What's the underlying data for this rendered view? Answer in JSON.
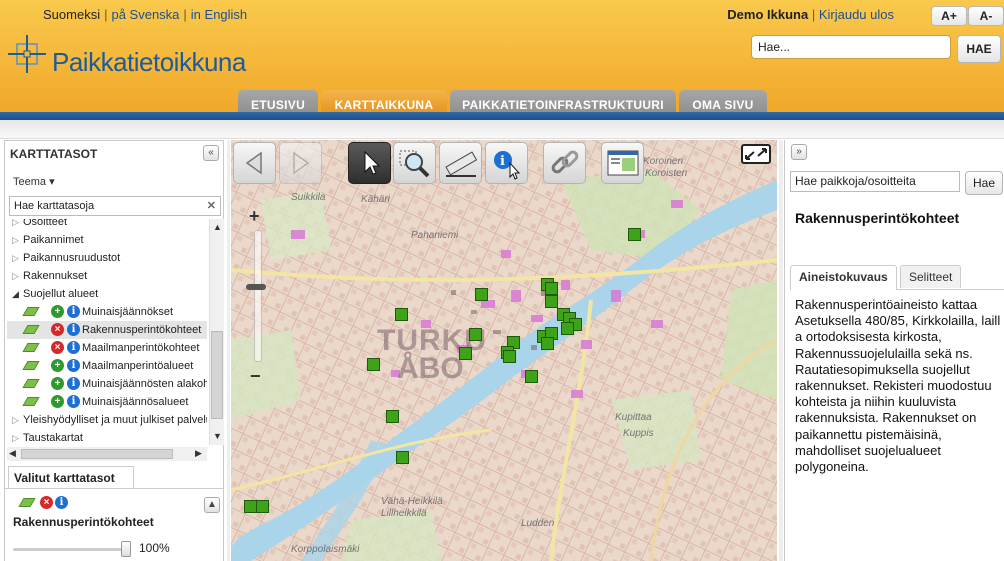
{
  "header": {
    "languages": [
      "Suomeksi",
      "på Svenska",
      "in English"
    ],
    "user_name": "Demo Ikkuna",
    "logout": "Kirjaudu ulos",
    "font_bigger": "A+",
    "font_smaller": "A-",
    "logo_text": "Paikkatietoikkuna",
    "search_placeholder": "Hae...",
    "search_button": "HAE"
  },
  "nav": {
    "tabs": [
      {
        "label": "ETUSIVU",
        "active": false
      },
      {
        "label": "KARTTAIKKUNA",
        "active": true
      },
      {
        "label": "PAIKKATIETOINFRASTRUKTUURI",
        "active": false
      },
      {
        "label": "OMA SIVU",
        "active": false
      }
    ]
  },
  "left_panel": {
    "title": "KARTTATASOT",
    "theme_label": "Teema",
    "layer_search_value": "Hae karttatasoja",
    "tree": [
      {
        "label": "Osoitteet",
        "type": "group"
      },
      {
        "label": "Paikannimet",
        "type": "group"
      },
      {
        "label": "Paikannusruudustot",
        "type": "group"
      },
      {
        "label": "Rakennukset",
        "type": "group"
      },
      {
        "label": "Suojellut alueet",
        "type": "group-open"
      },
      {
        "label": "Muinaisjäännökset",
        "type": "layer",
        "action": "add"
      },
      {
        "label": "Rakennusperintökohteet",
        "type": "layer",
        "action": "remove",
        "selected": true
      },
      {
        "label": "Maailmanperintökohteet",
        "type": "layer",
        "action": "remove"
      },
      {
        "label": "Maailmanperintöalueet",
        "type": "layer",
        "action": "add"
      },
      {
        "label": "Muinaisjäännösten alakohteet",
        "type": "layer",
        "action": "add"
      },
      {
        "label": "Muinaisjäännösalueet",
        "type": "layer",
        "action": "add"
      },
      {
        "label": "Yleishyödylliset ja muut julkiset palvelut",
        "type": "group"
      },
      {
        "label": "Taustakartat",
        "type": "group"
      }
    ],
    "selected_tab": "Valitut karttatasot",
    "selected_layer_name": "Rakennusperintökohteet",
    "opacity": "100%",
    "opacity_value": 1.0
  },
  "map": {
    "label_city_fi": "TURKU",
    "label_city_sv": "ÅBO",
    "place_labels": [
      "Suikkila",
      "Kähäri",
      "Koroinen",
      "Koroisten",
      "Pahaniemi",
      "Kuppis",
      "Kupittaa",
      "Vähä-Heikkilä",
      "Lillheikkilä",
      "Ludden",
      "Korppolaismäki"
    ],
    "zoom_in": "+",
    "zoom_out": "−"
  },
  "right_panel": {
    "place_search_value": "Hae paikkoja/osoitteita",
    "place_search_button": "Hae",
    "title": "Rakennusperintökohteet",
    "tabs": [
      "Aineistokuvaus",
      "Selitteet"
    ],
    "description": "Rakennusperintöaineisto kattaa Asetuksella 480/85, Kirkkolailla, laill a ortodoksisesta kirkosta, Rakennussuojelulailla sekä ns. Rautatiesopimuksella suojellut rakennukset. Rekisteri muodostuu kohteista ja niihin kuuluvista rakennuksista. Rakennukset on paikannettu pistemäisinä, mahdolliset suojelualueet polygoneina."
  },
  "colors": {
    "header_orange": "#f5b73a",
    "nav_active": "#e9941f",
    "brand_blue": "#1e5b9a",
    "poi_green": "#3ea319"
  }
}
